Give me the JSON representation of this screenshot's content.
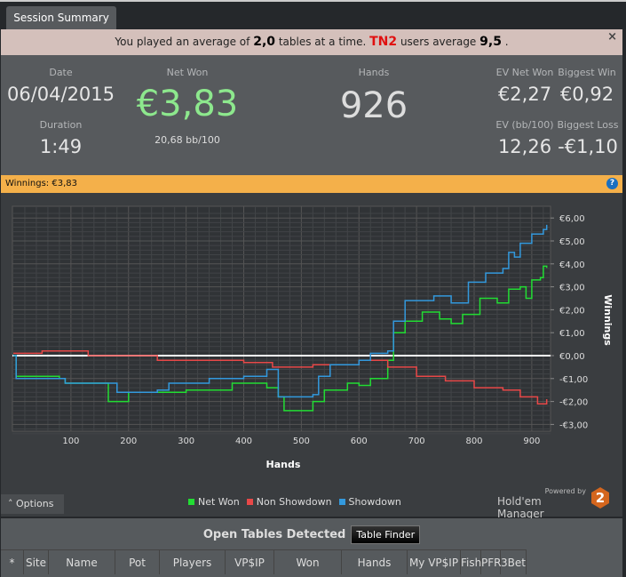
{
  "tab": {
    "label": "Session Summary"
  },
  "banner": {
    "pre": "You played an average of",
    "tables": "2,0",
    "mid": "tables at a time.",
    "site": "TN2",
    "post": "users average",
    "avg": "9,5",
    "end": ".",
    "close": "×"
  },
  "stats": {
    "date_label": "Date",
    "date": "06/04/2015",
    "duration_label": "Duration",
    "duration": "1:49",
    "netwon_label": "Net Won",
    "netwon": "€3,83",
    "bb100": "20,68 bb/100",
    "hands_label": "Hands",
    "hands": "926",
    "evnet_label": "EV Net Won",
    "evnet": "€2,27",
    "bigwin_label": "Biggest Win",
    "bigwin": "€0,92",
    "evbb_label": "EV (bb/100)",
    "evbb": "12,26",
    "bigloss_label": "Biggest Loss",
    "bigloss": "-€1,10"
  },
  "winnings_bar": {
    "label": "Winnings: €3,83",
    "help": "?"
  },
  "chart_data": {
    "type": "line",
    "xlabel": "Hands",
    "ylabel": "Winnings",
    "xlim": [
      0,
      926
    ],
    "ylim": [
      -3.5,
      6.5
    ],
    "xticks": [
      100,
      200,
      300,
      400,
      500,
      600,
      700,
      800,
      900
    ],
    "yticks": [
      {
        "v": 6,
        "t": "€6,00"
      },
      {
        "v": 5,
        "t": "€5,00"
      },
      {
        "v": 4,
        "t": "€4,00"
      },
      {
        "v": 3,
        "t": "€3,00"
      },
      {
        "v": 2,
        "t": "€2,00"
      },
      {
        "v": 1,
        "t": "€1,00"
      },
      {
        "v": 0,
        "t": "€0,00"
      },
      {
        "v": -1,
        "t": "-€1,00"
      },
      {
        "v": -2,
        "t": "-€2,00"
      },
      {
        "v": -3,
        "t": "-€3,00"
      }
    ],
    "series": [
      {
        "name": "Net Won",
        "color": "#22dd33",
        "points": [
          [
            0,
            0
          ],
          [
            5,
            -0.9
          ],
          [
            80,
            -1.0
          ],
          [
            90,
            -1.2
          ],
          [
            160,
            -1.2
          ],
          [
            165,
            -2.0
          ],
          [
            200,
            -1.6
          ],
          [
            260,
            -1.6
          ],
          [
            300,
            -1.5
          ],
          [
            380,
            -1.2
          ],
          [
            440,
            -1.4
          ],
          [
            460,
            -1.8
          ],
          [
            470,
            -2.4
          ],
          [
            510,
            -2.4
          ],
          [
            520,
            -2.0
          ],
          [
            540,
            -1.5
          ],
          [
            580,
            -1.2
          ],
          [
            600,
            -1.3
          ],
          [
            620,
            -1.0
          ],
          [
            650,
            -0.2
          ],
          [
            660,
            1.0
          ],
          [
            680,
            1.5
          ],
          [
            710,
            1.9
          ],
          [
            740,
            1.6
          ],
          [
            760,
            1.4
          ],
          [
            780,
            1.8
          ],
          [
            810,
            2.5
          ],
          [
            840,
            2.3
          ],
          [
            860,
            2.9
          ],
          [
            880,
            3.0
          ],
          [
            890,
            2.5
          ],
          [
            900,
            3.3
          ],
          [
            915,
            3.4
          ],
          [
            920,
            3.9
          ],
          [
            926,
            3.83
          ]
        ]
      },
      {
        "name": "Non Showdown",
        "color": "#e84848",
        "points": [
          [
            0,
            0.1
          ],
          [
            50,
            0.2
          ],
          [
            130,
            0.0
          ],
          [
            250,
            -0.2
          ],
          [
            400,
            -0.3
          ],
          [
            450,
            -0.5
          ],
          [
            520,
            -0.4
          ],
          [
            600,
            -0.2
          ],
          [
            650,
            -0.5
          ],
          [
            700,
            -0.9
          ],
          [
            750,
            -1.1
          ],
          [
            800,
            -1.4
          ],
          [
            850,
            -1.5
          ],
          [
            880,
            -1.8
          ],
          [
            910,
            -2.1
          ],
          [
            926,
            -1.9
          ]
        ]
      },
      {
        "name": "Showdown",
        "color": "#3399dd",
        "points": [
          [
            0,
            0
          ],
          [
            5,
            -1.0
          ],
          [
            80,
            -1.0
          ],
          [
            90,
            -1.2
          ],
          [
            160,
            -1.2
          ],
          [
            180,
            -1.6
          ],
          [
            250,
            -1.5
          ],
          [
            270,
            -1.2
          ],
          [
            340,
            -1.0
          ],
          [
            400,
            -0.9
          ],
          [
            440,
            -0.6
          ],
          [
            460,
            -1.8
          ],
          [
            520,
            -1.7
          ],
          [
            530,
            -0.9
          ],
          [
            550,
            -0.4
          ],
          [
            600,
            -0.2
          ],
          [
            620,
            0.1
          ],
          [
            650,
            0.2
          ],
          [
            660,
            1.5
          ],
          [
            680,
            2.4
          ],
          [
            730,
            2.6
          ],
          [
            760,
            2.3
          ],
          [
            790,
            3.2
          ],
          [
            820,
            3.6
          ],
          [
            850,
            3.8
          ],
          [
            860,
            4.5
          ],
          [
            870,
            4.3
          ],
          [
            880,
            4.9
          ],
          [
            900,
            5.3
          ],
          [
            920,
            5.5
          ],
          [
            926,
            5.7
          ]
        ]
      }
    ]
  },
  "options": {
    "label": "Options"
  },
  "legend": [
    {
      "label": "Net Won",
      "color": "#22dd33"
    },
    {
      "label": "Non Showdown",
      "color": "#e84848"
    },
    {
      "label": "Showdown",
      "color": "#3399dd"
    }
  ],
  "brand": {
    "powered": "Powered by",
    "name": "Hold'em Manager",
    "logo": "2"
  },
  "tables": {
    "title": "Open Tables Detected",
    "finder": "Table Finder",
    "columns": [
      "*",
      "Site",
      "Name",
      "Pot",
      "Players",
      "VP$IP",
      "Won",
      "Hands",
      "My VP$IP",
      "Fish",
      "PFR",
      "3Bet"
    ]
  }
}
